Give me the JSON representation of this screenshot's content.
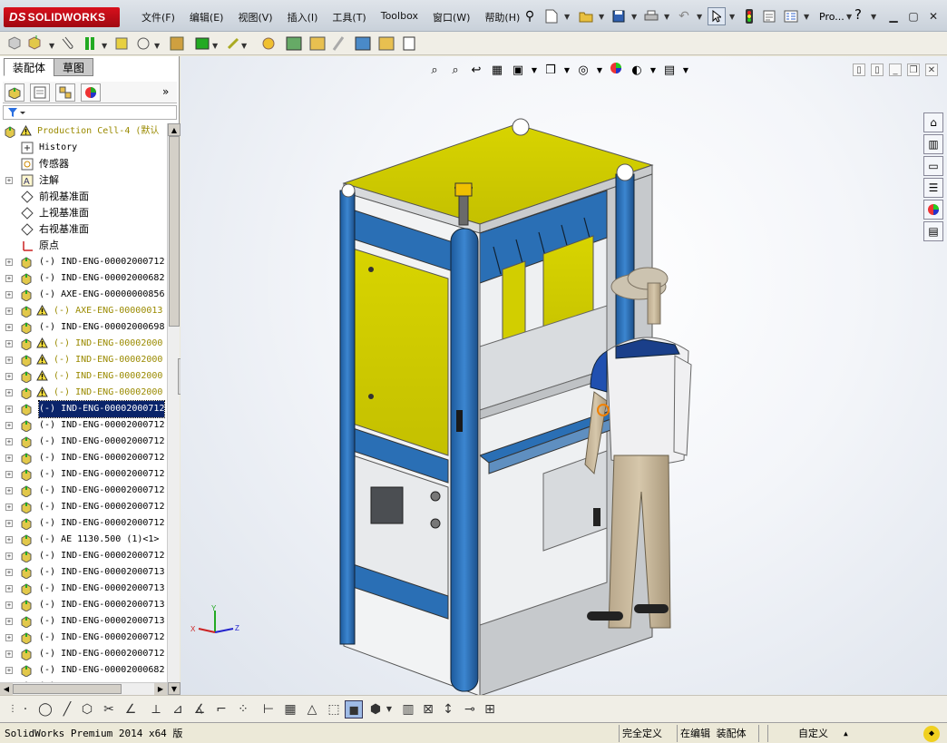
{
  "window": {
    "logo_ds": "DS",
    "logo_text": "SOLIDWORKS"
  },
  "menu": [
    "文件(F)",
    "编辑(E)",
    "视图(V)",
    "插入(I)",
    "工具(T)",
    "Toolbox",
    "窗口(W)",
    "帮助(H)"
  ],
  "titlebar": {
    "search_label": "Pro...",
    "help_icon": "?"
  },
  "panel": {
    "tabs": [
      "装配体",
      "草图"
    ],
    "collapse": "»",
    "tree": [
      {
        "label": "Production Cell-4  (默认",
        "icon": "assembly-icon",
        "warn": true,
        "yellow": true,
        "expand": false,
        "root": true
      },
      {
        "label": "History",
        "icon": "history-icon"
      },
      {
        "label": "传感器",
        "icon": "sensor-icon",
        "cjk": true
      },
      {
        "label": "注解",
        "icon": "annotation-icon",
        "cjk": true,
        "expand": true
      },
      {
        "label": "前视基准面",
        "icon": "plane-icon",
        "cjk": true
      },
      {
        "label": "上视基准面",
        "icon": "plane-icon",
        "cjk": true
      },
      {
        "label": "右视基准面",
        "icon": "plane-icon",
        "cjk": true
      },
      {
        "label": "原点",
        "icon": "origin-icon",
        "cjk": true
      },
      {
        "label": "(-) IND-ENG-00002000712",
        "icon": "part-icon",
        "expand": true
      },
      {
        "label": "(-) IND-ENG-00002000682",
        "icon": "part-icon",
        "expand": true
      },
      {
        "label": "(-) AXE-ENG-00000000856",
        "icon": "part-icon",
        "expand": true
      },
      {
        "label": "(-) AXE-ENG-00000013",
        "icon": "part-icon",
        "warn": true,
        "yellow": true,
        "expand": true
      },
      {
        "label": "(-) IND-ENG-00002000698",
        "icon": "part-icon",
        "expand": true
      },
      {
        "label": "(-) IND-ENG-00002000",
        "icon": "part-icon",
        "warn": true,
        "yellow": true,
        "expand": true
      },
      {
        "label": "(-) IND-ENG-00002000",
        "icon": "part-icon",
        "warn": true,
        "yellow": true,
        "expand": true
      },
      {
        "label": "(-) IND-ENG-00002000",
        "icon": "part-icon",
        "warn": true,
        "yellow": true,
        "expand": true
      },
      {
        "label": "(-) IND-ENG-00002000",
        "icon": "part-icon",
        "warn": true,
        "yellow": true,
        "expand": true
      },
      {
        "label": "(-) IND-ENG-00002000712",
        "icon": "part-icon",
        "expand": true,
        "selected": true
      },
      {
        "label": "(-) IND-ENG-00002000712",
        "icon": "part-icon",
        "expand": true
      },
      {
        "label": "(-) IND-ENG-00002000712",
        "icon": "part-icon",
        "expand": true
      },
      {
        "label": "(-) IND-ENG-00002000712",
        "icon": "part-icon",
        "expand": true
      },
      {
        "label": "(-) IND-ENG-00002000712",
        "icon": "part-icon",
        "expand": true
      },
      {
        "label": "(-) IND-ENG-00002000712",
        "icon": "part-icon",
        "expand": true
      },
      {
        "label": "(-) IND-ENG-00002000712",
        "icon": "part-icon",
        "expand": true
      },
      {
        "label": "(-) IND-ENG-00002000712",
        "icon": "part-icon",
        "expand": true
      },
      {
        "label": "(-) AE 1130.500  (1)<1>",
        "icon": "part-icon",
        "expand": true
      },
      {
        "label": "(-) IND-ENG-00002000712",
        "icon": "part-icon",
        "expand": true
      },
      {
        "label": "(-) IND-ENG-00002000713",
        "icon": "part-icon",
        "expand": true
      },
      {
        "label": "(-) IND-ENG-00002000713",
        "icon": "part-icon",
        "expand": true
      },
      {
        "label": "(-) IND-ENG-00002000713",
        "icon": "part-icon",
        "expand": true
      },
      {
        "label": "(-) IND-ENG-00002000713",
        "icon": "part-icon",
        "expand": true
      },
      {
        "label": "(-) IND-ENG-00002000712",
        "icon": "part-icon",
        "expand": true
      },
      {
        "label": "(-) IND-ENG-00002000712",
        "icon": "part-icon",
        "expand": true
      },
      {
        "label": "(-) IND-ENG-00002000682",
        "icon": "part-icon",
        "expand": true
      },
      {
        "label": "(-) IND-ENG-00002000682",
        "icon": "part-icon",
        "expand": true
      }
    ]
  },
  "triad": {
    "x": "X",
    "y": "Y",
    "z": "Z"
  },
  "statusbar": {
    "app": "SolidWorks Premium 2014 x64 版",
    "definition": "完全定义",
    "mode": "在编辑 装配体",
    "custom": "自定义"
  },
  "colors": {
    "panel_yellow": "#d4d000",
    "panel_blue": "#2a6fb5",
    "frame_gray": "#e4e6e8",
    "selection": "#0a246a",
    "warning_yellow": "#f6e03c"
  }
}
